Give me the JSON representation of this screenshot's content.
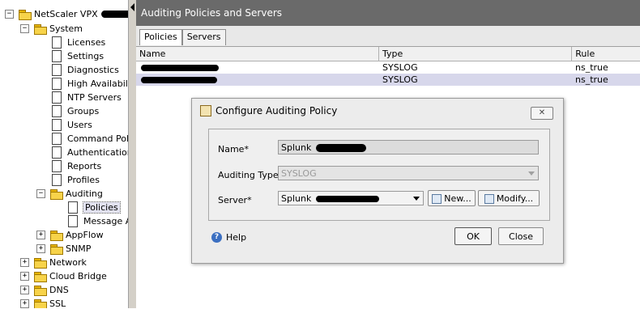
{
  "tree": {
    "root": "NetScaler VPX",
    "system": "System",
    "items": [
      "Licenses",
      "Settings",
      "Diagnostics",
      "High Availability",
      "NTP Servers",
      "Groups",
      "Users",
      "Command Polici",
      "Authentication",
      "Reports",
      "Profiles"
    ],
    "auditing": "Auditing",
    "auditing_children": [
      "Policies",
      "Message A"
    ],
    "appflow": "AppFlow",
    "snmp": "SNMP",
    "network": "Network",
    "cloud_bridge": "Cloud Bridge",
    "dns": "DNS",
    "ssl": "SSL",
    "expand_plus": "+",
    "expand_minus": "−"
  },
  "panel": {
    "title": "Auditing Policies and Servers",
    "tabs": [
      "Policies",
      "Servers"
    ],
    "columns": [
      "Name",
      "Type",
      "Rule"
    ],
    "rows": [
      {
        "name": "",
        "type": "SYSLOG",
        "rule": "ns_true"
      },
      {
        "name": "",
        "type": "SYSLOG",
        "rule": "ns_true"
      }
    ]
  },
  "dialog": {
    "title": "Configure Auditing Policy",
    "close_label": "✕",
    "name_label": "Name*",
    "name_value": "Splunk",
    "auditing_type_label": "Auditing Type",
    "auditing_type_value": "SYSLOG",
    "server_label": "Server*",
    "server_value": "Splunk",
    "new_button": "New...",
    "modify_button": "Modify...",
    "help_label": "Help",
    "ok_button": "OK",
    "close_button": "Close"
  },
  "icons": {
    "folder": "folder-icon",
    "document": "document-icon",
    "help": "help-icon"
  }
}
